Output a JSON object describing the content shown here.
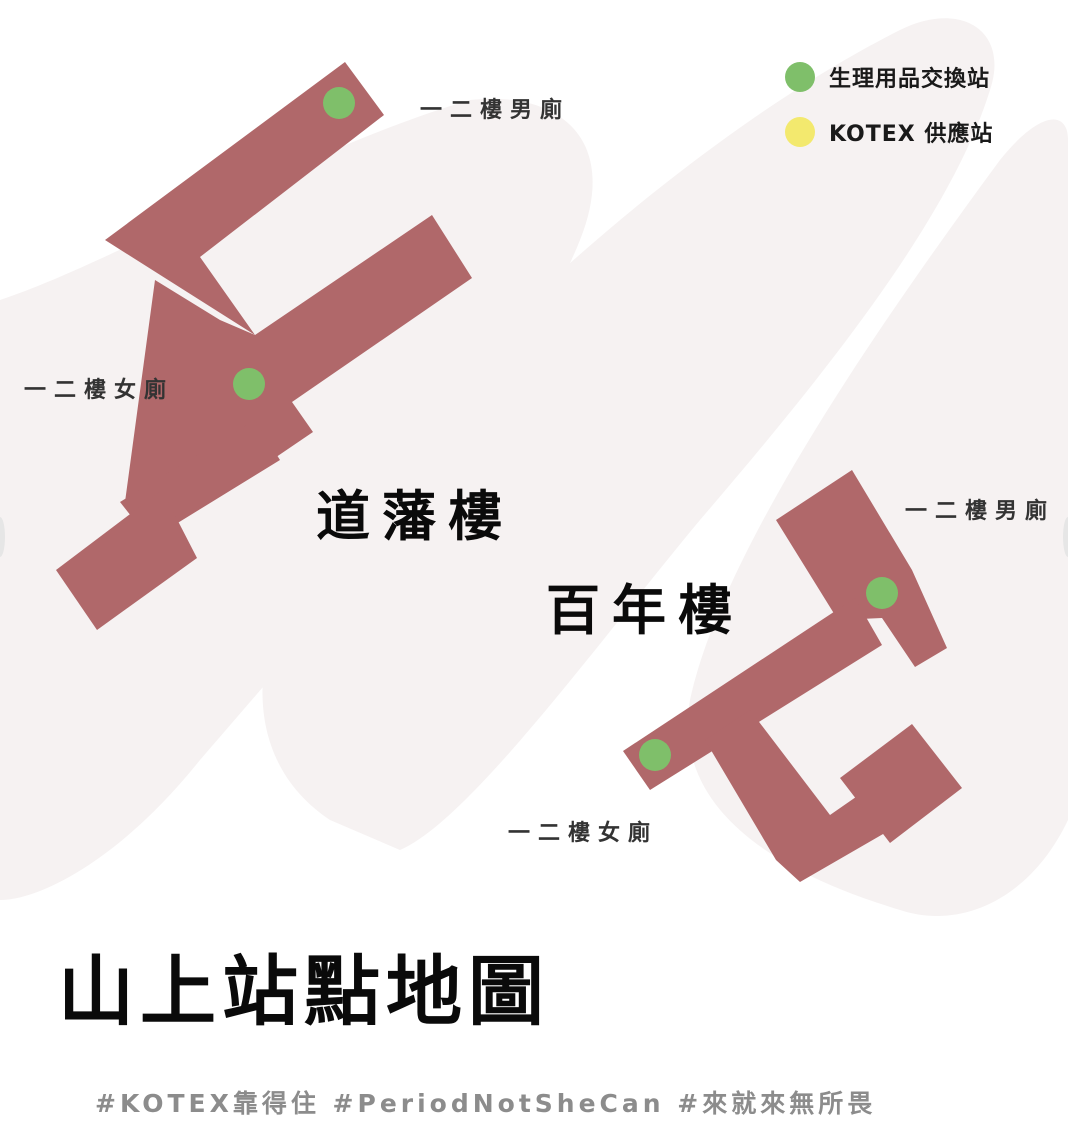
{
  "colors": {
    "building": "#b0686a",
    "exchange_station": "#7fbf6a",
    "kotex_station": "#f3e96e",
    "background_stroke": "#f6f2f2"
  },
  "legend": [
    {
      "label": "生理用品交換站",
      "color": "#7fbf6a"
    },
    {
      "label": "KOTEX 供應站",
      "color": "#f3e96e"
    }
  ],
  "buildings": {
    "daofan": {
      "name": "道藩樓",
      "restroom_men": "一二樓男廁",
      "restroom_women": "一二樓女廁"
    },
    "bainian": {
      "name": "百年樓",
      "restroom_men": "一二樓男廁",
      "restroom_women": "一二樓女廁"
    }
  },
  "title": "山上站點地圖",
  "hashtags": "#KOTEX靠得住 #PeriodNotSheCan #來就來無所畏"
}
